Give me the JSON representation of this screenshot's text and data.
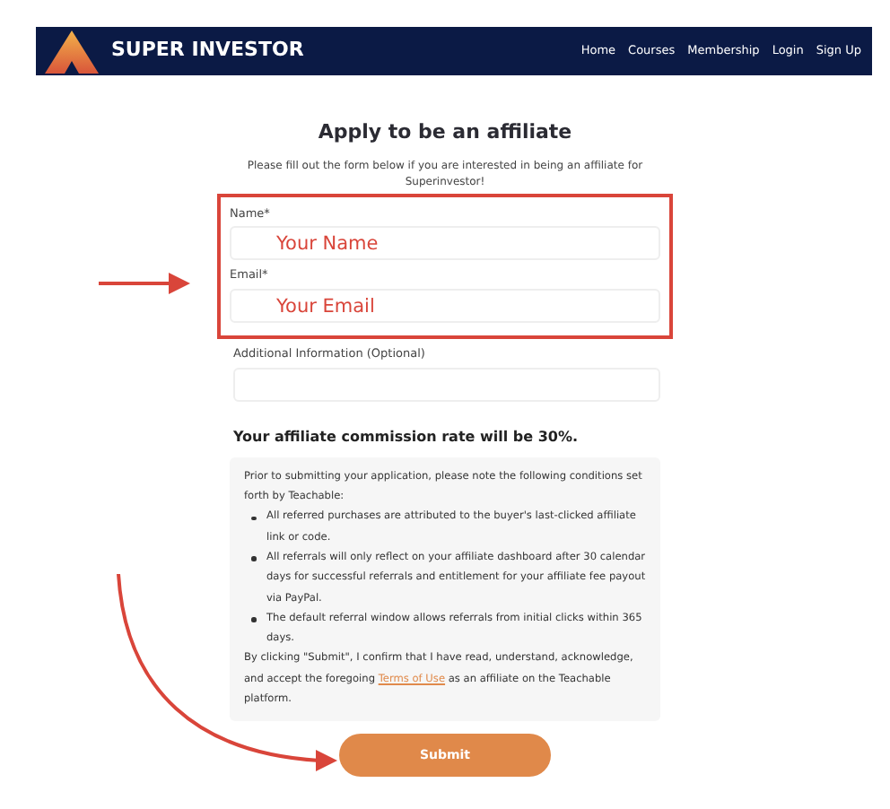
{
  "navbar": {
    "brand": "SUPER INVESTOR",
    "links": [
      "Home",
      "Courses",
      "Membership",
      "Login",
      "Sign Up"
    ]
  },
  "form": {
    "title": "Apply to be an affiliate",
    "subtitle": "Please fill out the form below if you are interested in being an affiliate for Superinvestor!",
    "fields": [
      {
        "label": "Name*",
        "annotation": "Your Name",
        "highlighted": true
      },
      {
        "label": "Email*",
        "annotation": "Your Email",
        "highlighted": true
      },
      {
        "label": "Additional Information (Optional)",
        "highlighted": false
      }
    ],
    "commission": "Your affiliate commission rate will be 30%.",
    "notice": {
      "intro": "Prior to submitting your application, please note the following conditions set forth by Teachable:",
      "bullets": [
        "All referred purchases are attributed to the buyer's last-clicked affiliate link or code.",
        "All referrals will only reflect on your affiliate dashboard after 30 calendar days for successful referrals and entitlement for your affiliate fee payout via PayPal.",
        "The default referral window allows referrals from initial clicks within 365 days."
      ],
      "outro_before": "By clicking \"Submit\", I confirm that I have read, understand, acknowledge, and accept the foregoing",
      "link": "Terms of Use",
      "outro_after": "as an affiliate on the Teachable platform."
    },
    "submit": "Submit"
  }
}
